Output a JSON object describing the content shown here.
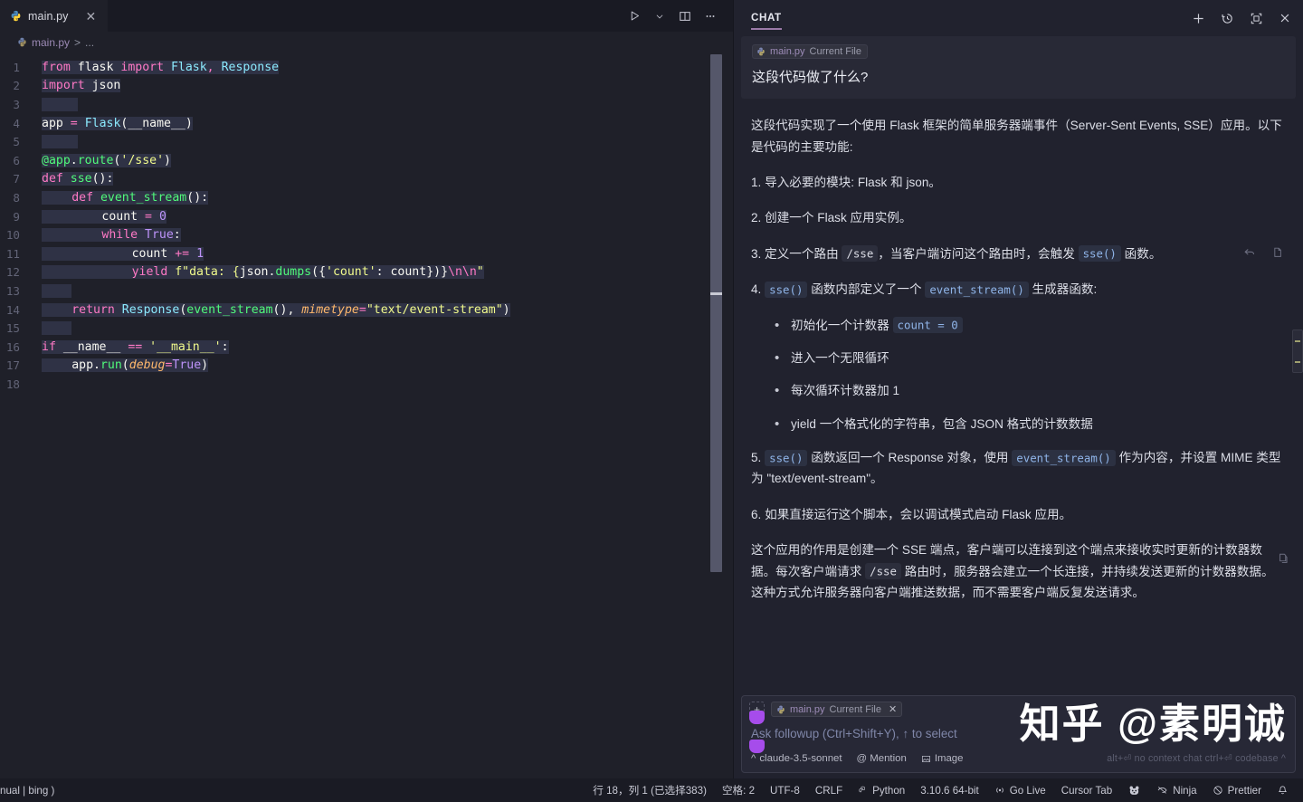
{
  "editor": {
    "tab": {
      "title": "main.py",
      "icon": "python-icon",
      "close": "✕"
    },
    "breadcrumb": {
      "file": "main.py",
      "sep": ">",
      "dots": "..."
    },
    "actions": {
      "run": "run-icon",
      "run_chevron": "chevron-down-icon",
      "split": "split-editor-icon",
      "more": "more-actions-icon"
    },
    "lines": [
      "1",
      "2",
      "3",
      "4",
      "5",
      "6",
      "7",
      "8",
      "9",
      "10",
      "11",
      "12",
      "13",
      "14",
      "15",
      "16",
      "17",
      "18"
    ],
    "code": {
      "l1": {
        "kw_from": "from",
        "mod_flask": "flask",
        "kw_import": "import",
        "cls_flask": "Flask",
        "comma": ",",
        "cls_response": "Response"
      },
      "l2": {
        "kw_import": "import",
        "mod_json": "json"
      },
      "l4": {
        "var_app": "app",
        "op_eq": "=",
        "cls_flask": "Flask",
        "lp": "(",
        "dunder": "__name__",
        "rp": ")"
      },
      "l6": {
        "decorator": "@app",
        "dot": ".",
        "route": "route",
        "lp": "(",
        "str": "'/sse'",
        "rp": ")"
      },
      "l7": {
        "kw_def": "def",
        "fn": "sse",
        "tail": "():"
      },
      "l8": {
        "kw_def": "def",
        "fn": "event_stream",
        "tail": "():"
      },
      "l9": {
        "var": "count",
        "op": "=",
        "num": "0"
      },
      "l10": {
        "kw_while": "while",
        "kw_true": "True",
        "colon": ":"
      },
      "l11": {
        "var": "count",
        "op": "+=",
        "num": "1"
      },
      "l12": {
        "kw_yield": "yield",
        "fstr_start": "f\"data: {",
        "mod": "json",
        "dot": ".",
        "fn": "dumps",
        "lp": "(",
        "brace": "{",
        "key": "'count'",
        "colon": ": ",
        "val": "count",
        "close": "})}",
        "esc": "\\n\\n",
        "quote": "\""
      },
      "l14": {
        "kw_return": "return",
        "cls": "Response",
        "lp": "(",
        "fn": "event_stream",
        "call": "()",
        "comma": ", ",
        "param": "mimetype",
        "eq": "=",
        "str": "\"text/event-stream\"",
        "rp": ")"
      },
      "l16": {
        "kw_if": "if",
        "dunder": "__name__",
        "op": "==",
        "str": "'__main__'",
        "colon": ":"
      },
      "l17": {
        "var": "app",
        "dot": ".",
        "fn": "run",
        "lp": "(",
        "param": "debug",
        "eq": "=",
        "kw_true": "True",
        "rp": ")"
      }
    }
  },
  "chat": {
    "title": "CHAT",
    "header_actions": {
      "new": "new-chat-icon",
      "history": "history-icon",
      "maximize": "maximize-icon",
      "close": "close-icon"
    },
    "user_message": {
      "context_file": "main.py",
      "context_label": "Current File",
      "text": "这段代码做了什么?"
    },
    "response": {
      "intro": "这段代码实现了一个使用 Flask 框架的简单服务器端事件（Server-Sent Events, SSE）应用。以下是代码的主要功能:",
      "item1": "1. 导入必要的模块: Flask 和 json。",
      "item2": "2. 创建一个 Flask 应用实例。",
      "item3_a": "3. 定义一个路由 ",
      "item3_code1": "/sse",
      "item3_b": "，当客户端访问这个路由时，会触发 ",
      "item3_code2": "sse()",
      "item3_c": " 函数。",
      "item4_a": "4. ",
      "item4_code1": "sse()",
      "item4_b": " 函数内部定义了一个 ",
      "item4_code2": "event_stream()",
      "item4_c": " 生成器函数:",
      "bullet1_a": "初始化一个计数器 ",
      "bullet1_code": "count = 0",
      "bullet2": "进入一个无限循环",
      "bullet3": "每次循环计数器加 1",
      "bullet4": "yield 一个格式化的字符串，包含 JSON 格式的计数数据",
      "item5_a": "5. ",
      "item5_code1": "sse()",
      "item5_b": " 函数返回一个 Response 对象，使用 ",
      "item5_code2": "event_stream()",
      "item5_c": " 作为内容，并设置 MIME 类型为 \"text/event-stream\"。",
      "item6": "6. 如果直接运行这个脚本，会以调试模式启动 Flask 应用。",
      "summary_a": "这个应用的作用是创建一个 SSE 端点，客户端可以连接到这个端点来接收实时更新的计数器数据。每次客户端请求 ",
      "summary_code": "/sse",
      "summary_b": " 路由时，服务器会建立一个长连接，并持续发送更新的计数器数据。这种方式允许服务器向客户端推送数据，而不需要客户端反复发送请求。",
      "action_revert": "revert-icon",
      "action_copy": "copy-icon",
      "action_copy_bottom": "copy-icon"
    },
    "input": {
      "add_context": "+",
      "context_file": "main.py",
      "context_label": "Current File",
      "context_remove": "✕",
      "placeholder": "Ask followup (Ctrl+Shift+Y), ↑ to select",
      "model": "claude-3.5-sonnet",
      "model_chevron": "^",
      "mention": "@ Mention",
      "image": "Image",
      "hint": "alt+⏎ no context chat  ctrl+⏎ codebase ^"
    }
  },
  "watermark": "知乎 @素明诚",
  "statusbar": {
    "left": "nual | bing )",
    "cursor": "行 18，列 1 (已选择383)",
    "spaces": "空格: 2",
    "encoding": "UTF-8",
    "eol": "CRLF",
    "language": "Python",
    "interpreter": "3.10.6 64-bit",
    "golive": "Go Live",
    "cursor_tab": "Cursor Tab",
    "panda": "panda-icon",
    "ninja": "Ninja",
    "prettier": "Prettier",
    "bell": "bell-icon"
  }
}
